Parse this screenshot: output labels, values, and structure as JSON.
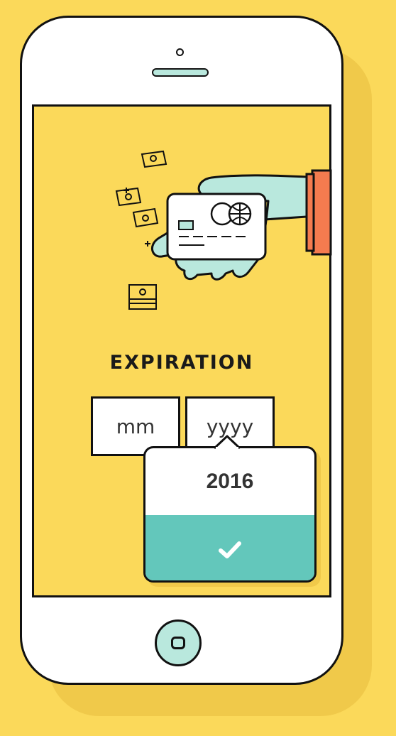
{
  "screen": {
    "title": "EXPIRATION",
    "fields": {
      "month_placeholder": "mm",
      "year_placeholder": "yyyy"
    },
    "year_picker": {
      "selected_value": "2016",
      "confirm_icon": "checkmark-icon"
    }
  },
  "colors": {
    "background": "#fbd95a",
    "accent": "#63c7bb",
    "hand": "#b9e8dd",
    "sleeve": "#f47b4f"
  }
}
